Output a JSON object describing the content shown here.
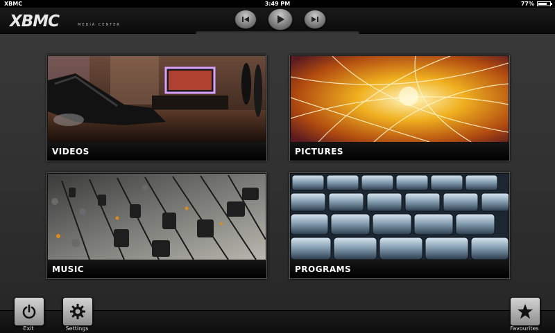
{
  "statusbar": {
    "carrier": "XBMC",
    "time": "3:49 PM",
    "battery": "77%",
    "battery_level": 0.77
  },
  "header": {
    "logo": "XBMC",
    "logo_subtitle": "MEDIA CENTER",
    "transport": [
      "previous-icon",
      "play-icon",
      "next-icon"
    ]
  },
  "tiles": [
    {
      "label": "VIDEOS"
    },
    {
      "label": "PICTURES"
    },
    {
      "label": "MUSIC"
    },
    {
      "label": "PROGRAMS"
    }
  ],
  "footer": {
    "exit_label": "Exit",
    "settings_label": "Settings",
    "favourites_label": "Favourites"
  },
  "colors": {
    "background": "#2f2f2f",
    "bar": "#0e0e0e",
    "caption": "#000000",
    "text": "#ffffff"
  }
}
